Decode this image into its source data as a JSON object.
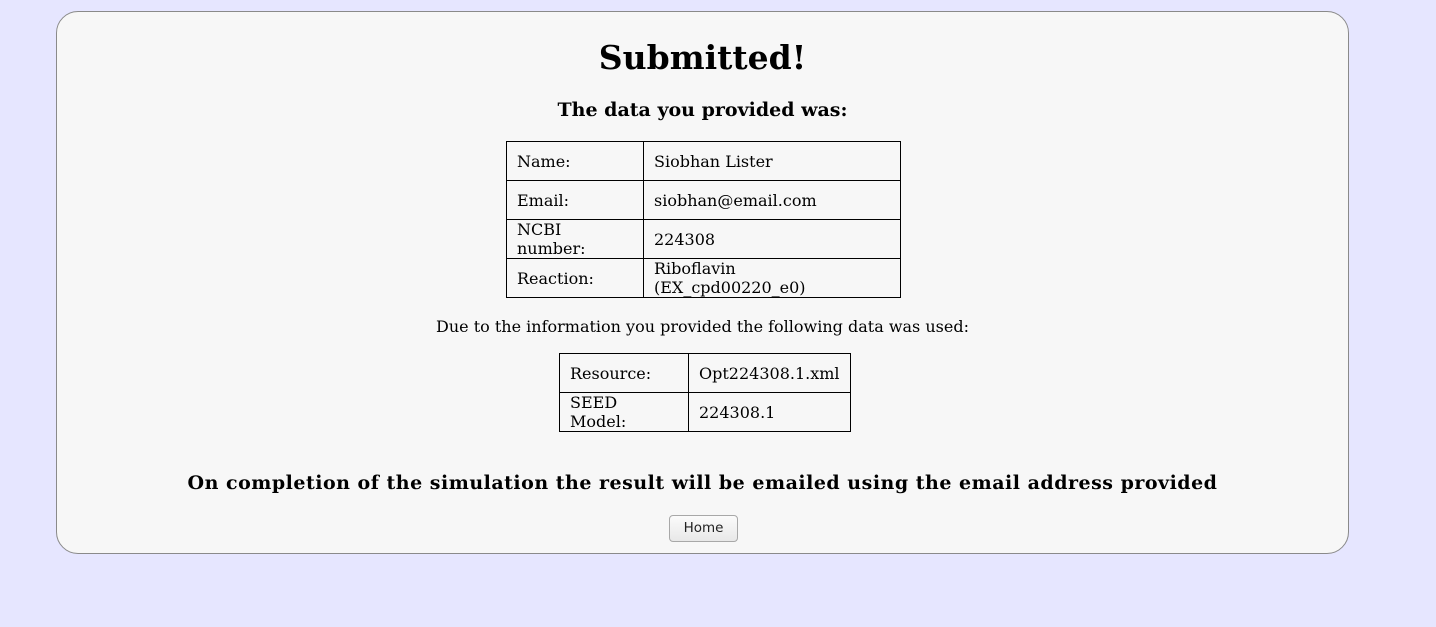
{
  "page": {
    "title": "Submitted!",
    "subtitle": "The data you provided was:",
    "note": "Due to the information you provided the following data was used:",
    "completion": "On completion of the simulation the result will be emailed using the email address provided",
    "home_button": "Home"
  },
  "provided": [
    {
      "label": "Name:",
      "value": "Siobhan Lister"
    },
    {
      "label": "Email:",
      "value": "siobhan@email.com"
    },
    {
      "label": "NCBI number:",
      "value": "224308"
    },
    {
      "label": "Reaction:",
      "value": "Riboflavin (EX_cpd00220_e0)"
    }
  ],
  "used": [
    {
      "label": "Resource:",
      "value": "Opt224308.1.xml"
    },
    {
      "label": "SEED Model:",
      "value": "224308.1"
    }
  ],
  "colors": {
    "page_background": "#e6e6ff",
    "panel_background": "#f7f7f7",
    "panel_border": "#8a8a8a"
  }
}
